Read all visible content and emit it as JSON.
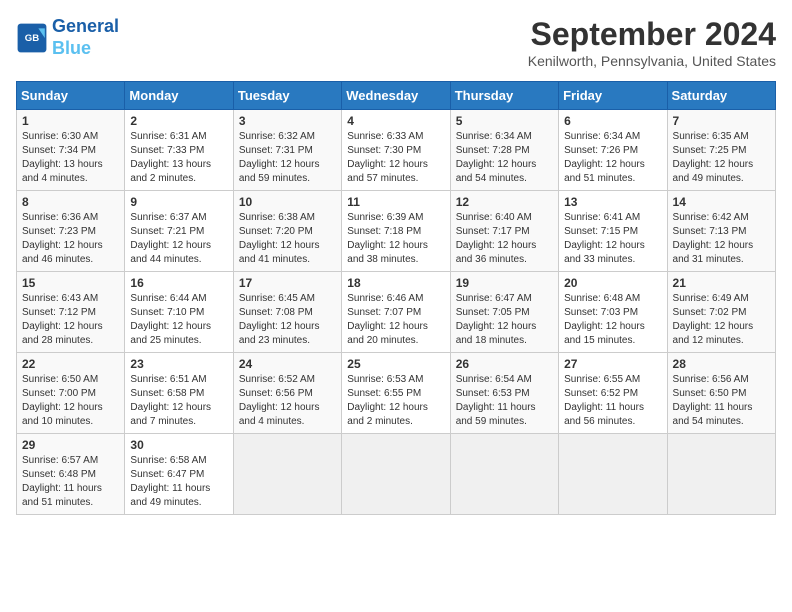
{
  "header": {
    "logo_line1": "General",
    "logo_line2": "Blue",
    "month_title": "September 2024",
    "location": "Kenilworth, Pennsylvania, United States"
  },
  "days_of_week": [
    "Sunday",
    "Monday",
    "Tuesday",
    "Wednesday",
    "Thursday",
    "Friday",
    "Saturday"
  ],
  "weeks": [
    [
      {
        "day": "1",
        "sunrise": "6:30 AM",
        "sunset": "7:34 PM",
        "daylight": "13 hours and 4 minutes."
      },
      {
        "day": "2",
        "sunrise": "6:31 AM",
        "sunset": "7:33 PM",
        "daylight": "13 hours and 2 minutes."
      },
      {
        "day": "3",
        "sunrise": "6:32 AM",
        "sunset": "7:31 PM",
        "daylight": "12 hours and 59 minutes."
      },
      {
        "day": "4",
        "sunrise": "6:33 AM",
        "sunset": "7:30 PM",
        "daylight": "12 hours and 57 minutes."
      },
      {
        "day": "5",
        "sunrise": "6:34 AM",
        "sunset": "7:28 PM",
        "daylight": "12 hours and 54 minutes."
      },
      {
        "day": "6",
        "sunrise": "6:34 AM",
        "sunset": "7:26 PM",
        "daylight": "12 hours and 51 minutes."
      },
      {
        "day": "7",
        "sunrise": "6:35 AM",
        "sunset": "7:25 PM",
        "daylight": "12 hours and 49 minutes."
      }
    ],
    [
      {
        "day": "8",
        "sunrise": "6:36 AM",
        "sunset": "7:23 PM",
        "daylight": "12 hours and 46 minutes."
      },
      {
        "day": "9",
        "sunrise": "6:37 AM",
        "sunset": "7:21 PM",
        "daylight": "12 hours and 44 minutes."
      },
      {
        "day": "10",
        "sunrise": "6:38 AM",
        "sunset": "7:20 PM",
        "daylight": "12 hours and 41 minutes."
      },
      {
        "day": "11",
        "sunrise": "6:39 AM",
        "sunset": "7:18 PM",
        "daylight": "12 hours and 38 minutes."
      },
      {
        "day": "12",
        "sunrise": "6:40 AM",
        "sunset": "7:17 PM",
        "daylight": "12 hours and 36 minutes."
      },
      {
        "day": "13",
        "sunrise": "6:41 AM",
        "sunset": "7:15 PM",
        "daylight": "12 hours and 33 minutes."
      },
      {
        "day": "14",
        "sunrise": "6:42 AM",
        "sunset": "7:13 PM",
        "daylight": "12 hours and 31 minutes."
      }
    ],
    [
      {
        "day": "15",
        "sunrise": "6:43 AM",
        "sunset": "7:12 PM",
        "daylight": "12 hours and 28 minutes."
      },
      {
        "day": "16",
        "sunrise": "6:44 AM",
        "sunset": "7:10 PM",
        "daylight": "12 hours and 25 minutes."
      },
      {
        "day": "17",
        "sunrise": "6:45 AM",
        "sunset": "7:08 PM",
        "daylight": "12 hours and 23 minutes."
      },
      {
        "day": "18",
        "sunrise": "6:46 AM",
        "sunset": "7:07 PM",
        "daylight": "12 hours and 20 minutes."
      },
      {
        "day": "19",
        "sunrise": "6:47 AM",
        "sunset": "7:05 PM",
        "daylight": "12 hours and 18 minutes."
      },
      {
        "day": "20",
        "sunrise": "6:48 AM",
        "sunset": "7:03 PM",
        "daylight": "12 hours and 15 minutes."
      },
      {
        "day": "21",
        "sunrise": "6:49 AM",
        "sunset": "7:02 PM",
        "daylight": "12 hours and 12 minutes."
      }
    ],
    [
      {
        "day": "22",
        "sunrise": "6:50 AM",
        "sunset": "7:00 PM",
        "daylight": "12 hours and 10 minutes."
      },
      {
        "day": "23",
        "sunrise": "6:51 AM",
        "sunset": "6:58 PM",
        "daylight": "12 hours and 7 minutes."
      },
      {
        "day": "24",
        "sunrise": "6:52 AM",
        "sunset": "6:56 PM",
        "daylight": "12 hours and 4 minutes."
      },
      {
        "day": "25",
        "sunrise": "6:53 AM",
        "sunset": "6:55 PM",
        "daylight": "12 hours and 2 minutes."
      },
      {
        "day": "26",
        "sunrise": "6:54 AM",
        "sunset": "6:53 PM",
        "daylight": "11 hours and 59 minutes."
      },
      {
        "day": "27",
        "sunrise": "6:55 AM",
        "sunset": "6:52 PM",
        "daylight": "11 hours and 56 minutes."
      },
      {
        "day": "28",
        "sunrise": "6:56 AM",
        "sunset": "6:50 PM",
        "daylight": "11 hours and 54 minutes."
      }
    ],
    [
      {
        "day": "29",
        "sunrise": "6:57 AM",
        "sunset": "6:48 PM",
        "daylight": "11 hours and 51 minutes."
      },
      {
        "day": "30",
        "sunrise": "6:58 AM",
        "sunset": "6:47 PM",
        "daylight": "11 hours and 49 minutes."
      },
      null,
      null,
      null,
      null,
      null
    ]
  ]
}
